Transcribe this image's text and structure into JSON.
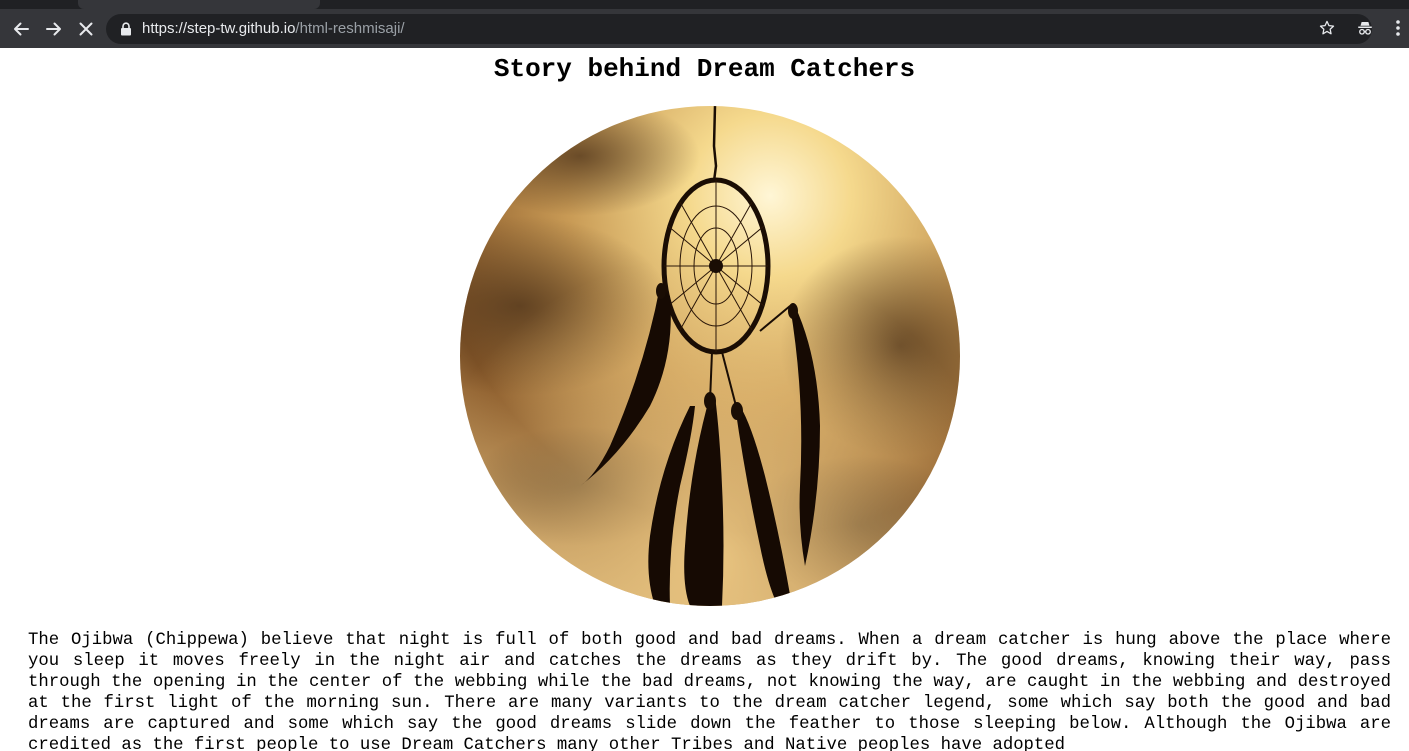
{
  "browser": {
    "url_host": "https://step-tw.github.io",
    "url_path": "/html-reshmisaji/",
    "icons": {
      "back": "arrow-left-icon",
      "forward": "arrow-right-icon",
      "stop": "close-icon",
      "lock": "lock-icon",
      "bookmark": "star-icon",
      "incognito": "incognito-icon",
      "menu": "vertical-dots-icon"
    },
    "colors": {
      "chrome_dark": "#202124",
      "chrome_toolbar": "#35363a",
      "icon": "#e8eaed"
    }
  },
  "page": {
    "title": "Story behind Dream Catchers",
    "hero_image_alt_icon": "dream-catcher-image",
    "paragraph": "The Ojibwa (Chippewa) believe that night is full of both good and bad dreams. When a dream catcher is hung above the place where you sleep it moves freely in the night air and catches the dreams as they drift by. The good dreams, knowing their way, pass through the opening in the center of the webbing while the bad dreams, not knowing the way, are caught in the webbing and destroyed at the first light of the morning sun. There are many variants to the dream catcher legend, some which say both the good and bad dreams are captured and some which say the good dreams slide down the feather to those sleeping below. Although the Ojibwa are credited as the first people to use Dream Catchers many other Tribes and Native peoples have adopted"
  }
}
